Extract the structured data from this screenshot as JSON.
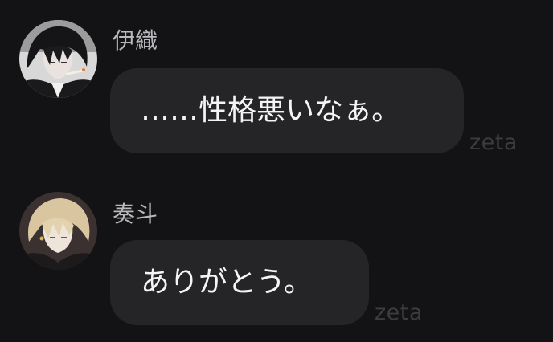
{
  "messages": [
    {
      "sender": "伊織",
      "text": "……性格悪いなぁ。",
      "watermark": "zeta",
      "avatar_icon": "character-avatar-dark-hair"
    },
    {
      "sender": "奏斗",
      "text": "ありがとう。",
      "watermark": "zeta",
      "avatar_icon": "character-avatar-blond-hair"
    }
  ],
  "colors": {
    "background": "#131315",
    "bubble": "#252528",
    "sender_text": "#b9b9bd",
    "message_text": "#f4f4f4",
    "watermark": "#3c3c40"
  }
}
